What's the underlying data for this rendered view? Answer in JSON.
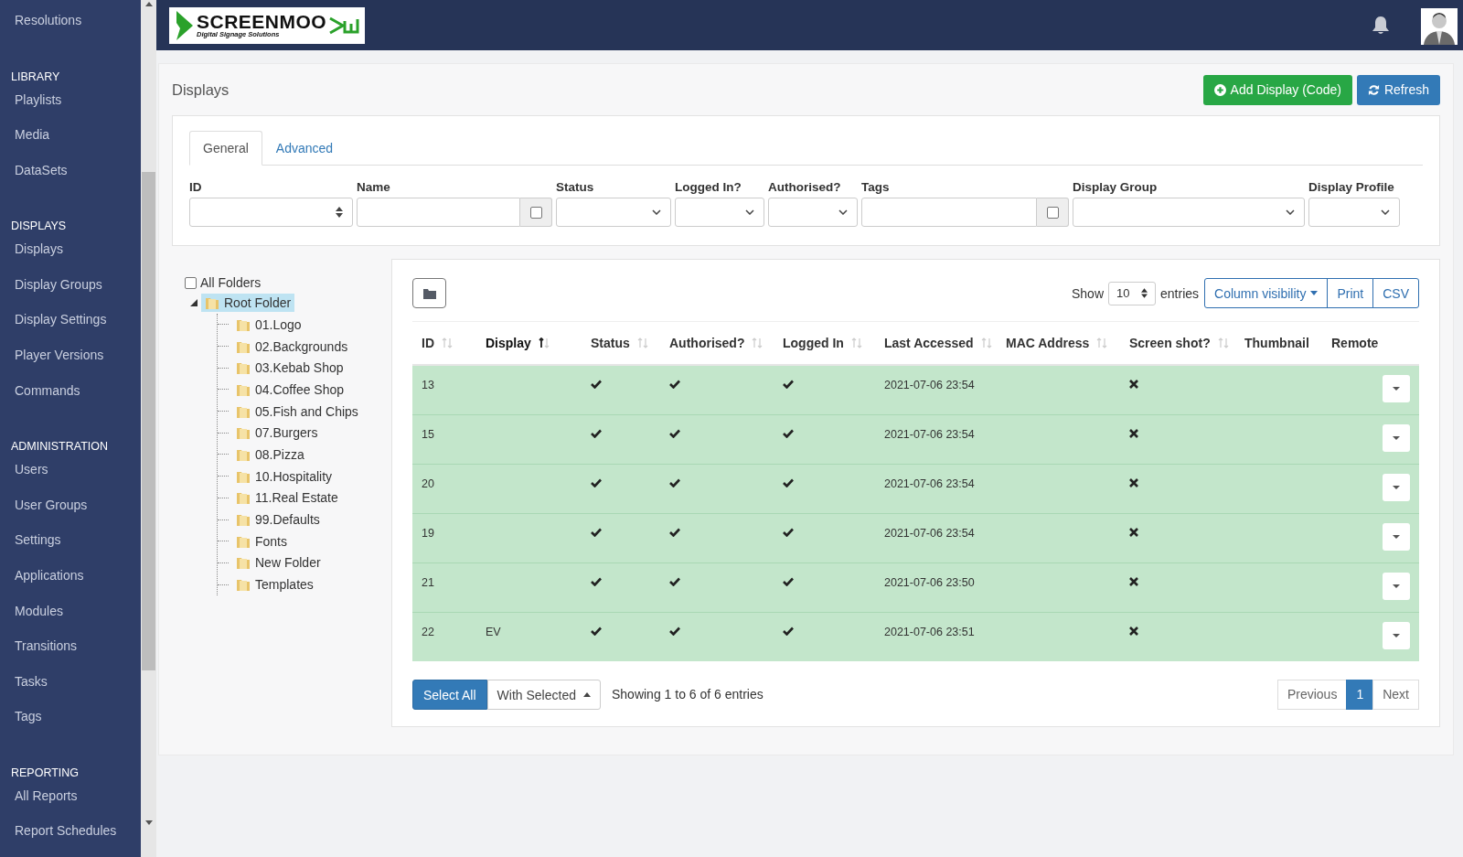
{
  "sidebar": {
    "sections": [
      {
        "items": [
          "Resolutions"
        ]
      },
      {
        "heading": "LIBRARY",
        "items": [
          "Playlists",
          "Media",
          "DataSets"
        ]
      },
      {
        "heading": "DISPLAYS",
        "items": [
          "Displays",
          "Display Groups",
          "Display Settings",
          "Player Versions",
          "Commands"
        ]
      },
      {
        "heading": "ADMINISTRATION",
        "items": [
          "Users",
          "User Groups",
          "Settings",
          "Applications",
          "Modules",
          "Transitions",
          "Tasks",
          "Tags"
        ]
      },
      {
        "heading": "REPORTING",
        "items": [
          "All Reports",
          "Report Schedules"
        ]
      }
    ]
  },
  "header": {
    "logo": {
      "name": "SCREENMOO",
      "tagline": "Digital Signage Solutions"
    }
  },
  "page": {
    "title": "Displays",
    "buttons": [
      {
        "label": "Add Display (Code)",
        "kind": "add"
      },
      {
        "label": "Refresh",
        "kind": "refresh"
      }
    ]
  },
  "filter_tabs": [
    {
      "label": "General",
      "selected": true
    },
    {
      "label": "Advanced",
      "selected": false
    }
  ],
  "filters": [
    {
      "label": "ID",
      "kind": "number"
    },
    {
      "label": "Name",
      "kind": "text",
      "checked": false
    },
    {
      "label": "Status",
      "kind": "select"
    },
    {
      "label": "Logged In?",
      "kind": "select"
    },
    {
      "label": "Authorised?",
      "kind": "select"
    },
    {
      "label": "Tags",
      "kind": "text",
      "checked": false
    },
    {
      "label": "Display Group",
      "kind": "select"
    },
    {
      "label": "Display Profile",
      "kind": "select"
    }
  ],
  "folders": {
    "all": {
      "label": "All Folders",
      "checked": false
    },
    "root": {
      "label": "Root Folder",
      "selected": true,
      "expanded": true,
      "children": [
        {
          "label": "01.Logo",
          "selected": false
        },
        {
          "label": "02.Backgrounds",
          "selected": false
        },
        {
          "label": "03.Kebab Shop",
          "selected": false
        },
        {
          "label": "04.Coffee Shop",
          "selected": false
        },
        {
          "label": "05.Fish and Chips",
          "selected": false
        },
        {
          "label": "07.Burgers",
          "selected": false
        },
        {
          "label": "08.Pizza",
          "selected": false
        },
        {
          "label": "10.Hospitality",
          "selected": false
        },
        {
          "label": "11.Real Estate",
          "selected": false
        },
        {
          "label": "99.Defaults",
          "selected": false
        },
        {
          "label": "Fonts",
          "selected": false
        },
        {
          "label": "New Folder",
          "selected": false
        },
        {
          "label": "Templates",
          "selected": false
        }
      ]
    }
  },
  "table": {
    "show_label": "Show",
    "page_size": "10",
    "entries_label": "entries",
    "buttons": [
      {
        "label": "Column visibility",
        "kind": "dropdown"
      },
      {
        "label": "Print",
        "kind": "plain"
      },
      {
        "label": "CSV",
        "kind": "plain"
      }
    ],
    "columns": [
      {
        "label": "ID",
        "sortable": true,
        "sorted": false
      },
      {
        "label": "Display",
        "sortable": true,
        "sorted": true
      },
      {
        "label": "Status",
        "sortable": true,
        "sorted": false
      },
      {
        "label": "Authorised?",
        "sortable": true,
        "sorted": false
      },
      {
        "label": "Logged In",
        "sortable": true,
        "sorted": false
      },
      {
        "label": "Last Accessed",
        "sortable": true,
        "sorted": false
      },
      {
        "label": "MAC Address",
        "sortable": true,
        "sorted": false
      },
      {
        "label": "Screen shot?",
        "sortable": true,
        "sorted": false
      },
      {
        "label": "Thumbnail",
        "sortable": false,
        "sorted": false
      },
      {
        "label": "Remote",
        "sortable": false,
        "sorted": false
      }
    ],
    "rows": [
      {
        "id": "13",
        "status": true,
        "authorised": true,
        "logged_in": true,
        "last_accessed": "2021-07-06 23:54",
        "screenshot": false
      },
      {
        "id": "15",
        "status": true,
        "authorised": true,
        "logged_in": true,
        "last_accessed": "2021-07-06 23:54",
        "screenshot": false
      },
      {
        "id": "20",
        "status": true,
        "authorised": true,
        "logged_in": true,
        "last_accessed": "2021-07-06 23:54",
        "screenshot": false
      },
      {
        "id": "19",
        "status": true,
        "authorised": true,
        "logged_in": true,
        "last_accessed": "2021-07-06 23:54",
        "screenshot": false
      },
      {
        "id": "21",
        "status": true,
        "authorised": true,
        "logged_in": true,
        "last_accessed": "2021-07-06 23:50",
        "screenshot": false
      },
      {
        "id": "22",
        "display": "EV",
        "status": true,
        "authorised": true,
        "logged_in": true,
        "last_accessed": "2021-07-06 23:51",
        "screenshot": false
      }
    ],
    "select_all": "Select All",
    "with_selected": "With Selected",
    "info": "Showing 1 to 6 of 6 entries",
    "pagination": [
      {
        "label": "Previous",
        "selected": false
      },
      {
        "label": "1",
        "selected": true
      },
      {
        "label": "Next",
        "selected": false
      }
    ]
  }
}
